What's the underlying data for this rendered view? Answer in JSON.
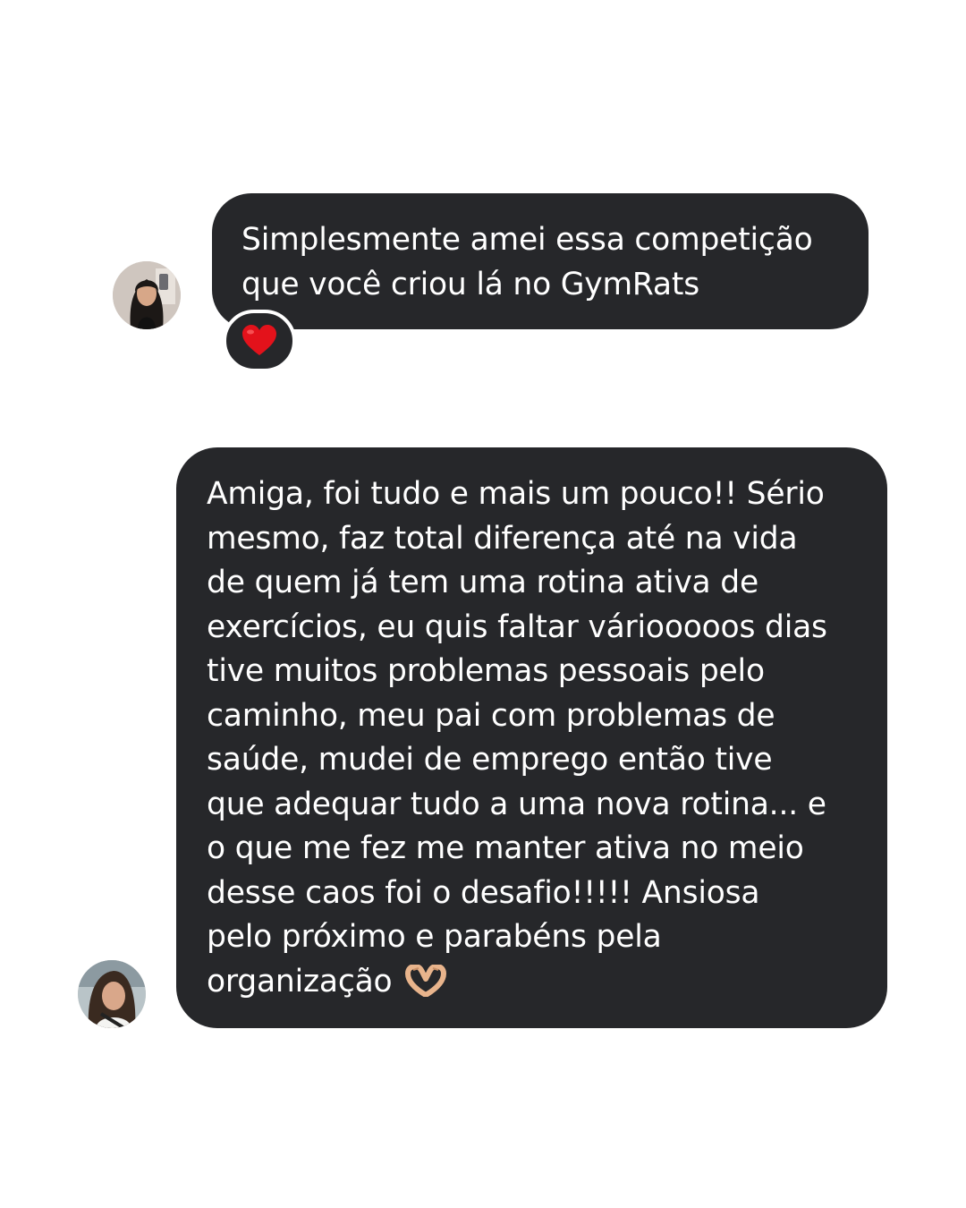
{
  "conversation": {
    "messages": [
      {
        "text": "Simplesmente amei essa competição\nque você criou lá no GymRats",
        "reaction": "heart-emoji",
        "reaction_color": "#e3121b"
      },
      {
        "text": "Amiga, foi tudo e mais um pouco!! Sério\nmesmo, faz total diferença até na vida\nde quem já tem uma rotina ativa de\nexercícios, eu quis faltar váriooooos dias\ntive muitos problemas pessoais pelo\ncaminho, meu pai com problemas de\nsaúde, mudei de emprego então tive\nque adequar tudo a uma nova rotina... e\no que me fez me manter ativa no meio\ndesse caos foi o desafio!!!!! Ansiosa\npelo próximo e parabéns pela\norganização",
        "trailing_emoji": "heart-hands-emoji"
      }
    ]
  },
  "colors": {
    "bubble": "#26272a",
    "text": "#ffffff",
    "background": "#ffffff"
  }
}
